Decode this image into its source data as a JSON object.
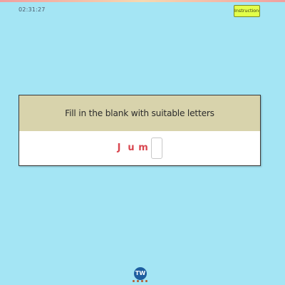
{
  "header": {
    "timer": "02:31:27",
    "instructions_label": "Instructions"
  },
  "question": {
    "prompt": "Fill in the blank with suitable letters",
    "letters": [
      "J",
      "u",
      "m"
    ],
    "blank_value": ""
  },
  "footer": {
    "logo_text": "TW"
  },
  "colors": {
    "background": "#a4e5f4",
    "card_header": "#d8d3ac",
    "letter": "#d9464f",
    "instructions_button": "#e3ff4a"
  }
}
